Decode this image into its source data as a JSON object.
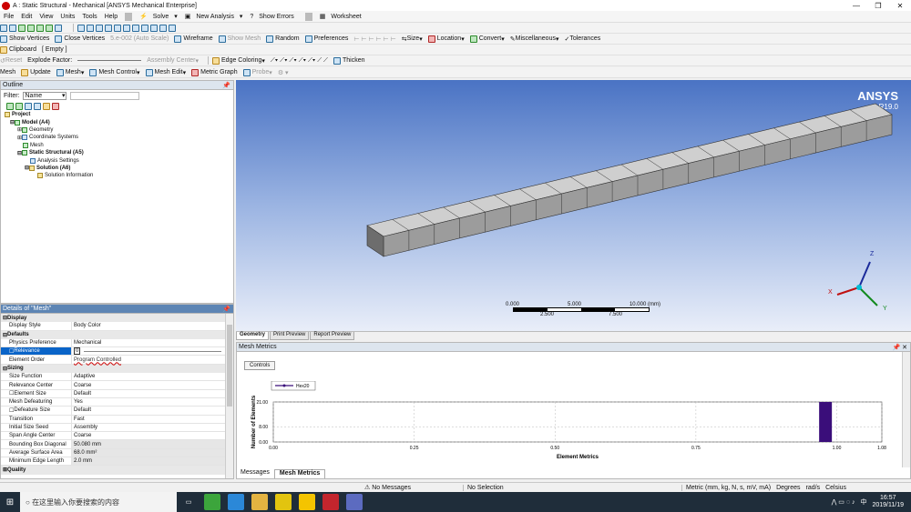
{
  "window": {
    "title": "A : Static Structural - Mechanical [ANSYS Mechanical Enterprise]"
  },
  "menu": [
    "File",
    "Edit",
    "View",
    "Units",
    "Tools",
    "Help"
  ],
  "toolbar1": {
    "solve": "Solve",
    "new_analysis": "New Analysis",
    "show_errors": "Show Errors",
    "worksheet": "Worksheet"
  },
  "toolbar2": {
    "show_vertices": "Show Vertices",
    "close_vertices": "Close Vertices",
    "auto_scale": "5.e-002 (Auto Scale)",
    "wireframe": "Wireframe",
    "show_mesh": "Show Mesh",
    "random": "Random",
    "preferences": "Preferences",
    "size": "Size",
    "location": "Location",
    "convert": "Convert",
    "miscellaneous": "Miscellaneous",
    "tolerances": "Tolerances"
  },
  "toolbar3": {
    "clipboard": "Clipboard",
    "empty": "[ Empty ]"
  },
  "toolbar4": {
    "reset": "Reset",
    "explode_factor": "Explode Factor:",
    "assembly_center": "Assembly Center",
    "edge_coloring": "Edge Coloring",
    "thicken": "Thicken"
  },
  "toolbar5": {
    "mesh": "Mesh",
    "update": "Update",
    "mesh_btn": "Mesh",
    "mesh_control": "Mesh Control",
    "mesh_edit": "Mesh Edit",
    "metric_graph": "Metric Graph",
    "probe": "Probe"
  },
  "outline": {
    "title": "Outline",
    "filter_label": "Filter:",
    "filter_value": "Name",
    "tree": [
      "Project",
      "Model (A4)",
      "Geometry",
      "Coordinate Systems",
      "Mesh",
      "Static Structural (A5)",
      "Analysis Settings",
      "Solution (A6)",
      "Solution Information"
    ]
  },
  "details": {
    "title": "Details of \"Mesh\"",
    "display": "Display",
    "display_style": "Display Style",
    "body_color": "Body Color",
    "defaults": "Defaults",
    "physics_pref": "Physics Preference",
    "mechanical": "Mechanical",
    "relevance": "Relevance",
    "relevance_val": "0",
    "element_order": "Element Order",
    "program_controlled": "Program Controlled",
    "sizing": "Sizing",
    "size_function": "Size Function",
    "adaptive": "Adaptive",
    "relevance_center": "Relevance Center",
    "coarse": "Coarse",
    "element_size": "Element Size",
    "default": "Default",
    "mesh_defeaturing": "Mesh Defeaturing",
    "yes": "Yes",
    "defeature_size": "Defeature Size",
    "transition": "Transition",
    "fast": "Fast",
    "initial_size_seed": "Initial Size Seed",
    "assembly": "Assembly",
    "span_angle_center": "Span Angle Center",
    "bounding_box": "Bounding Box Diagonal",
    "bounding_box_val": "50.080 mm",
    "avg_surface": "Average Surface Area",
    "avg_surface_val": "68.0 mm²",
    "min_edge": "Minimum Edge Length",
    "min_edge_val": "2.0 mm",
    "quality": "Quality"
  },
  "viewport": {
    "brand": "ANSYS",
    "version": "R19.0",
    "scale_top": [
      "0.000",
      "5.000",
      "10.000 (mm)"
    ],
    "scale_bottom": [
      "2.500",
      "7.500"
    ],
    "axes": {
      "x": "X",
      "y": "Y",
      "z": "Z"
    }
  },
  "view_tabs": [
    "Geometry",
    "Print Preview",
    "Report Preview"
  ],
  "mesh_metrics": {
    "title": "Mesh Metrics",
    "controls": "Controls"
  },
  "chart_data": {
    "type": "bar",
    "title": "",
    "xlabel": "Element Metrics",
    "ylabel": "Number of Elements",
    "series": [
      {
        "name": "Hex20",
        "values": [
          21
        ]
      }
    ],
    "x": [
      0.98
    ],
    "xlim": [
      0,
      1.08
    ],
    "ylim": [
      0,
      21
    ],
    "xticks": [
      "0.00",
      "0.25",
      "0.50",
      "0.75",
      "1.00",
      "1.08"
    ],
    "yticks": [
      "21.00",
      "8.00",
      "0.00"
    ]
  },
  "bottom_tabs": [
    "Messages",
    "Mesh Metrics"
  ],
  "status": {
    "messages": "No Messages",
    "selection": "No Selection",
    "units": "Metric (mm, kg, N, s, mV, mA)",
    "degrees": "Degrees",
    "rads": "rad/s",
    "temp": "Celsius"
  },
  "taskbar": {
    "search": "在这里输入你要搜索的内容",
    "time": "16:57",
    "date": "2019/11/19"
  },
  "colors": {
    "bar": "#3a0e7a",
    "panel_header": "#5d85b4",
    "selected": "#0a64c8"
  }
}
